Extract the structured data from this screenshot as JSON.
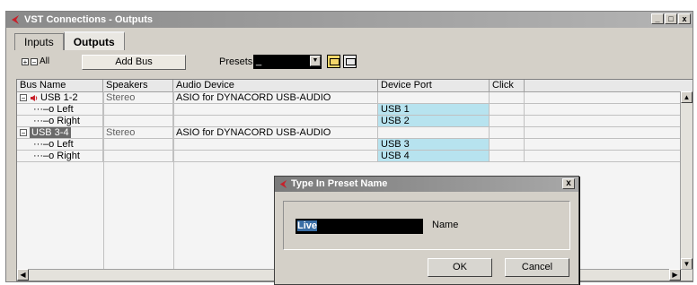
{
  "window": {
    "title": "VST Connections - Outputs",
    "controls": [
      "_",
      "□",
      "x"
    ]
  },
  "tabs": [
    {
      "label": "Inputs",
      "active": false
    },
    {
      "label": "Outputs",
      "active": true
    }
  ],
  "toolbar": {
    "all_label": "All",
    "add_bus_label": "Add Bus",
    "presets_label": "Presets",
    "presets_value": "_"
  },
  "table": {
    "columns": [
      "Bus Name",
      "Speakers",
      "Audio Device",
      "Device Port",
      "Click"
    ],
    "rows": [
      {
        "bus": "USB 1-2",
        "speakers": "Stereo",
        "device": "ASIO for DYNACORD USB-AUDIO",
        "port": "",
        "click": "",
        "level": 0
      },
      {
        "bus": "Left",
        "speakers": "",
        "device": "",
        "port": "USB 1",
        "click": "",
        "level": 1
      },
      {
        "bus": "Right",
        "speakers": "",
        "device": "",
        "port": "USB 2",
        "click": "",
        "level": 1
      },
      {
        "bus": "USB 3-4",
        "speakers": "Stereo",
        "device": "ASIO for DYNACORD USB-AUDIO",
        "port": "",
        "click": "",
        "level": 0
      },
      {
        "bus": "Left",
        "speakers": "",
        "device": "",
        "port": "USB 3",
        "click": "",
        "level": 1
      },
      {
        "bus": "Right",
        "speakers": "",
        "device": "",
        "port": "USB 4",
        "click": "",
        "level": 1
      }
    ]
  },
  "dialog": {
    "title": "Type In Preset Name",
    "close": "x",
    "input_value": "Live",
    "field_label": "Name",
    "ok_label": "OK",
    "cancel_label": "Cancel"
  },
  "colors": {
    "accent_logo": "#c8202a",
    "port_highlight": "#b7e3ef",
    "title_bar": "#9a9a9a"
  }
}
